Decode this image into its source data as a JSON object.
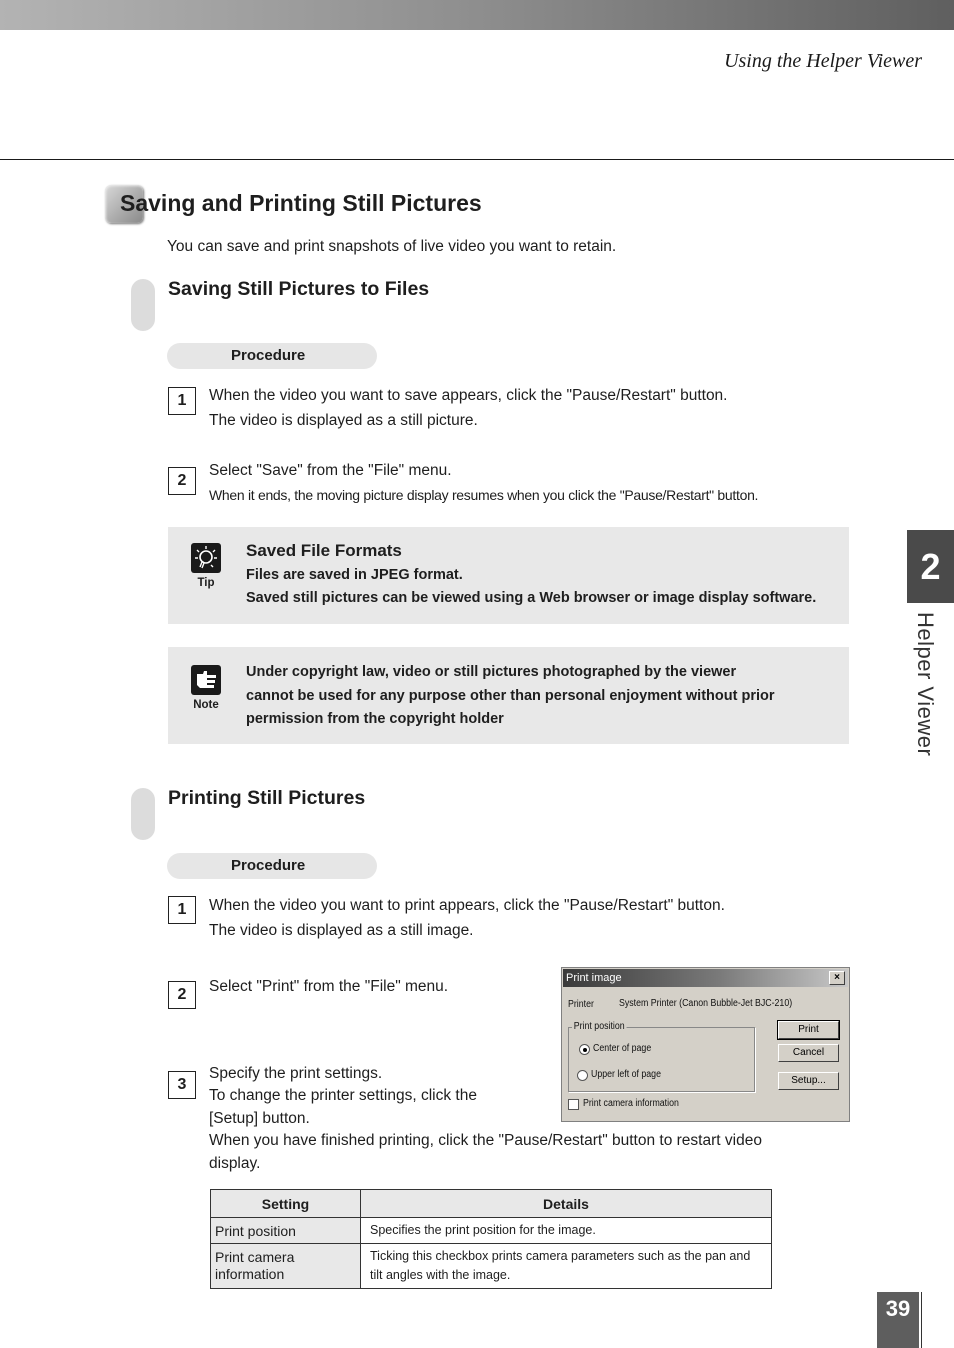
{
  "header": {
    "running_title": "Using the Helper Viewer"
  },
  "section": {
    "title": "Saving and Printing Still Pictures",
    "intro": "You can save and print snapshots of live video you want to retain."
  },
  "saving": {
    "title": "Saving Still Pictures to Files",
    "procedure_label": "Procedure",
    "steps": [
      {
        "number": "1",
        "lines": [
          "When the video you want to save appears, click the \"Pause/Restart\" button.",
          "The video is displayed as a still picture."
        ]
      },
      {
        "number": "2",
        "lines": [
          "Select \"Save\" from the \"File\" menu.",
          "When it ends, the moving picture display resumes when you click the \"Pause/Restart\" button."
        ]
      }
    ],
    "tip": {
      "icon": "lightbulb-icon",
      "label": "Tip",
      "title": "Saved File Formats",
      "lines": [
        "Files are saved in JPEG format.",
        "Saved still pictures can be viewed using a Web browser or image display software."
      ]
    },
    "note": {
      "icon": "pointing-hand-icon",
      "label": "Note",
      "lines": [
        "Under copyright law, video or still pictures photographed by the viewer",
        "cannot be used for any purpose other than personal enjoyment without prior",
        "permission from the copyright holder"
      ]
    }
  },
  "printing": {
    "title": "Printing Still Pictures",
    "procedure_label": "Procedure",
    "steps": [
      {
        "number": "1",
        "lines": [
          "When the video you want to print appears, click the \"Pause/Restart\" button.",
          "The video is displayed as a still image."
        ]
      },
      {
        "number": "2",
        "lines": [
          "Select \"Print\" from the \"File\" menu."
        ]
      },
      {
        "number": "3",
        "lines": [
          "Specify the print settings.",
          "To change the printer settings, click the",
          "[Setup] button.",
          "When you have finished printing, click the \"Pause/Restart\" button to restart video",
          "display."
        ]
      }
    ],
    "dialog": {
      "title": "Print image",
      "close_glyph": "×",
      "printer_label": "Printer",
      "printer_value": "System Printer (Canon Bubble-Jet BJC-210)",
      "group_label": "Print position",
      "options": [
        {
          "label": "Center of page",
          "selected": true
        },
        {
          "label": "Upper left of page",
          "selected": false
        }
      ],
      "checkbox_label": "Print camera information",
      "checkbox_checked": false,
      "buttons": {
        "print": "Print",
        "cancel": "Cancel",
        "setup": "Setup..."
      }
    },
    "table": {
      "headers": [
        "Setting",
        "Details"
      ],
      "rows": [
        {
          "setting": "Print position",
          "details": "Specifies the print position for the image."
        },
        {
          "setting": "Print camera information",
          "details": "Ticking this checkbox prints camera parameters such as the pan and tilt angles with the image."
        }
      ]
    }
  },
  "side_tab": {
    "chapter": "2",
    "label": "Helper Viewer"
  },
  "footer": {
    "page_number": "39"
  }
}
